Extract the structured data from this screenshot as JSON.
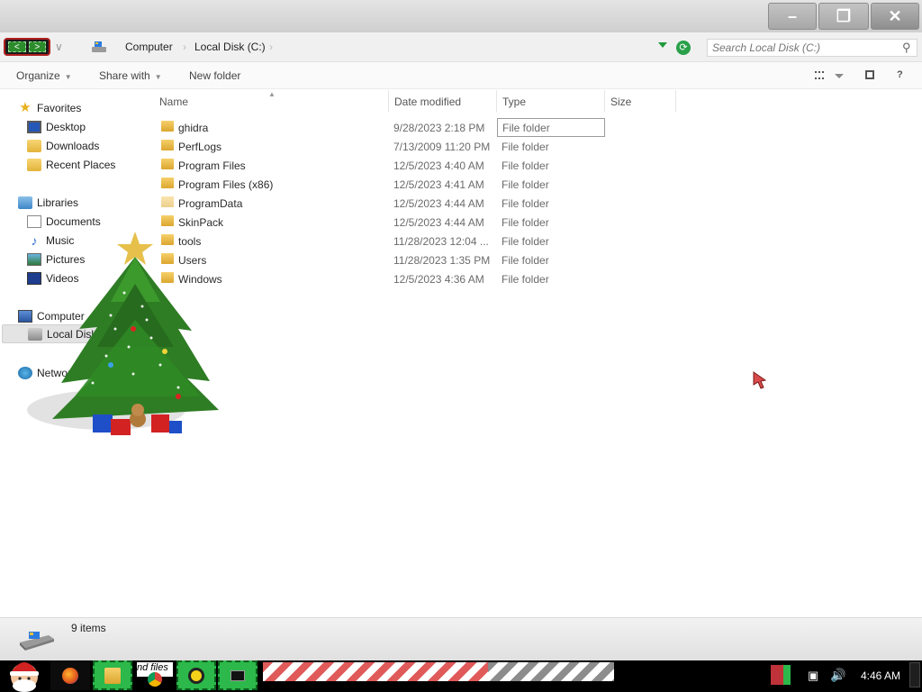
{
  "window": {
    "caption_buttons": {
      "minimize": "–",
      "maximize": "❐",
      "close": "✕"
    }
  },
  "address": {
    "nav_back": "<",
    "nav_forward": ">",
    "recent_caret": "∨",
    "breadcrumbs": [
      "Computer",
      "Local Disk (C:)"
    ],
    "refresh_glyph": "⟳",
    "search_placeholder": "Search Local Disk (C:)"
  },
  "toolbar": {
    "organize": "Organize",
    "share_with": "Share with",
    "new_folder": "New folder",
    "help": "?"
  },
  "nav_pane": {
    "favorites": {
      "label": "Favorites",
      "items": [
        "Desktop",
        "Downloads",
        "Recent Places"
      ]
    },
    "libraries": {
      "label": "Libraries",
      "items": [
        "Documents",
        "Music",
        "Pictures",
        "Videos"
      ]
    },
    "computer": {
      "label": "Computer",
      "items": [
        "Local Disk (C:)"
      ]
    },
    "network": {
      "label": "Network"
    }
  },
  "columns": [
    "Name",
    "Date modified",
    "Type",
    "Size"
  ],
  "files": [
    {
      "name": "ghidra",
      "date": "9/28/2023 2:18 PM",
      "type": "File folder"
    },
    {
      "name": "PerfLogs",
      "date": "7/13/2009 11:20 PM",
      "type": "File folder"
    },
    {
      "name": "Program Files",
      "date": "12/5/2023 4:40 AM",
      "type": "File folder"
    },
    {
      "name": "Program Files (x86)",
      "date": "12/5/2023 4:41 AM",
      "type": "File folder"
    },
    {
      "name": "ProgramData",
      "date": "12/5/2023 4:44 AM",
      "type": "File folder"
    },
    {
      "name": "SkinPack",
      "date": "12/5/2023 4:44 AM",
      "type": "File folder"
    },
    {
      "name": "tools",
      "date": "11/28/2023 12:04 ...",
      "type": "File folder"
    },
    {
      "name": "Users",
      "date": "11/28/2023 1:35 PM",
      "type": "File folder"
    },
    {
      "name": "Windows",
      "date": "12/5/2023 4:36 AM",
      "type": "File folder"
    }
  ],
  "details": {
    "count": "9 items"
  },
  "taskbar": {
    "label_fragment": "nd files",
    "clock": "4:46 AM",
    "tray_network_glyph": "▣",
    "tray_volume_glyph": "🔊"
  },
  "colors": {
    "nav_green": "#2c8c2c",
    "close_red_accent": "#b02020",
    "task_green": "#2cb84a",
    "stripe_red": "#e05a5a"
  }
}
